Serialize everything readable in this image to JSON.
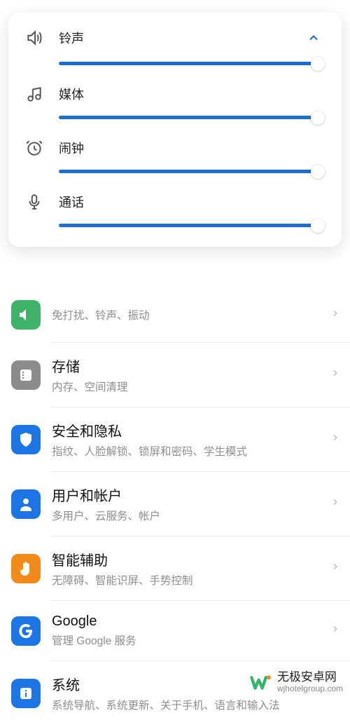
{
  "volume_panel": {
    "items": [
      {
        "label": "铃声",
        "icon": "speaker"
      },
      {
        "label": "媒体",
        "icon": "music"
      },
      {
        "label": "闹钟",
        "icon": "alarm"
      },
      {
        "label": "通话",
        "icon": "mic"
      }
    ]
  },
  "settings": [
    {
      "title": "",
      "sub": "免打扰、铃声、振动",
      "icon_bg": "#3fb36a",
      "icon": "sound",
      "partial": true
    },
    {
      "title": "存储",
      "sub": "内存、空间清理",
      "icon_bg": "#8c8c8c",
      "icon": "storage"
    },
    {
      "title": "安全和隐私",
      "sub": "指纹、人脸解锁、锁屏和密码、学生模式",
      "icon_bg": "#1d74e5",
      "icon": "shield"
    },
    {
      "title": "用户和帐户",
      "sub": "多用户、云服务、帐户",
      "icon_bg": "#1d74e5",
      "icon": "user"
    },
    {
      "title": "智能辅助",
      "sub": "无障碍、智能识屏、手势控制",
      "icon_bg": "#f28b1c",
      "icon": "hand"
    },
    {
      "title": "Google",
      "sub": "管理 Google 服务",
      "icon_bg": "#1d74e5",
      "icon": "google"
    },
    {
      "title": "系统",
      "sub": "系统导航、系统更新、关于手机、语言和输入法",
      "icon_bg": "#1d74e5",
      "icon": "info"
    }
  ],
  "watermark": {
    "title": "无极安卓网",
    "url": "wjhotelgroup.com"
  }
}
